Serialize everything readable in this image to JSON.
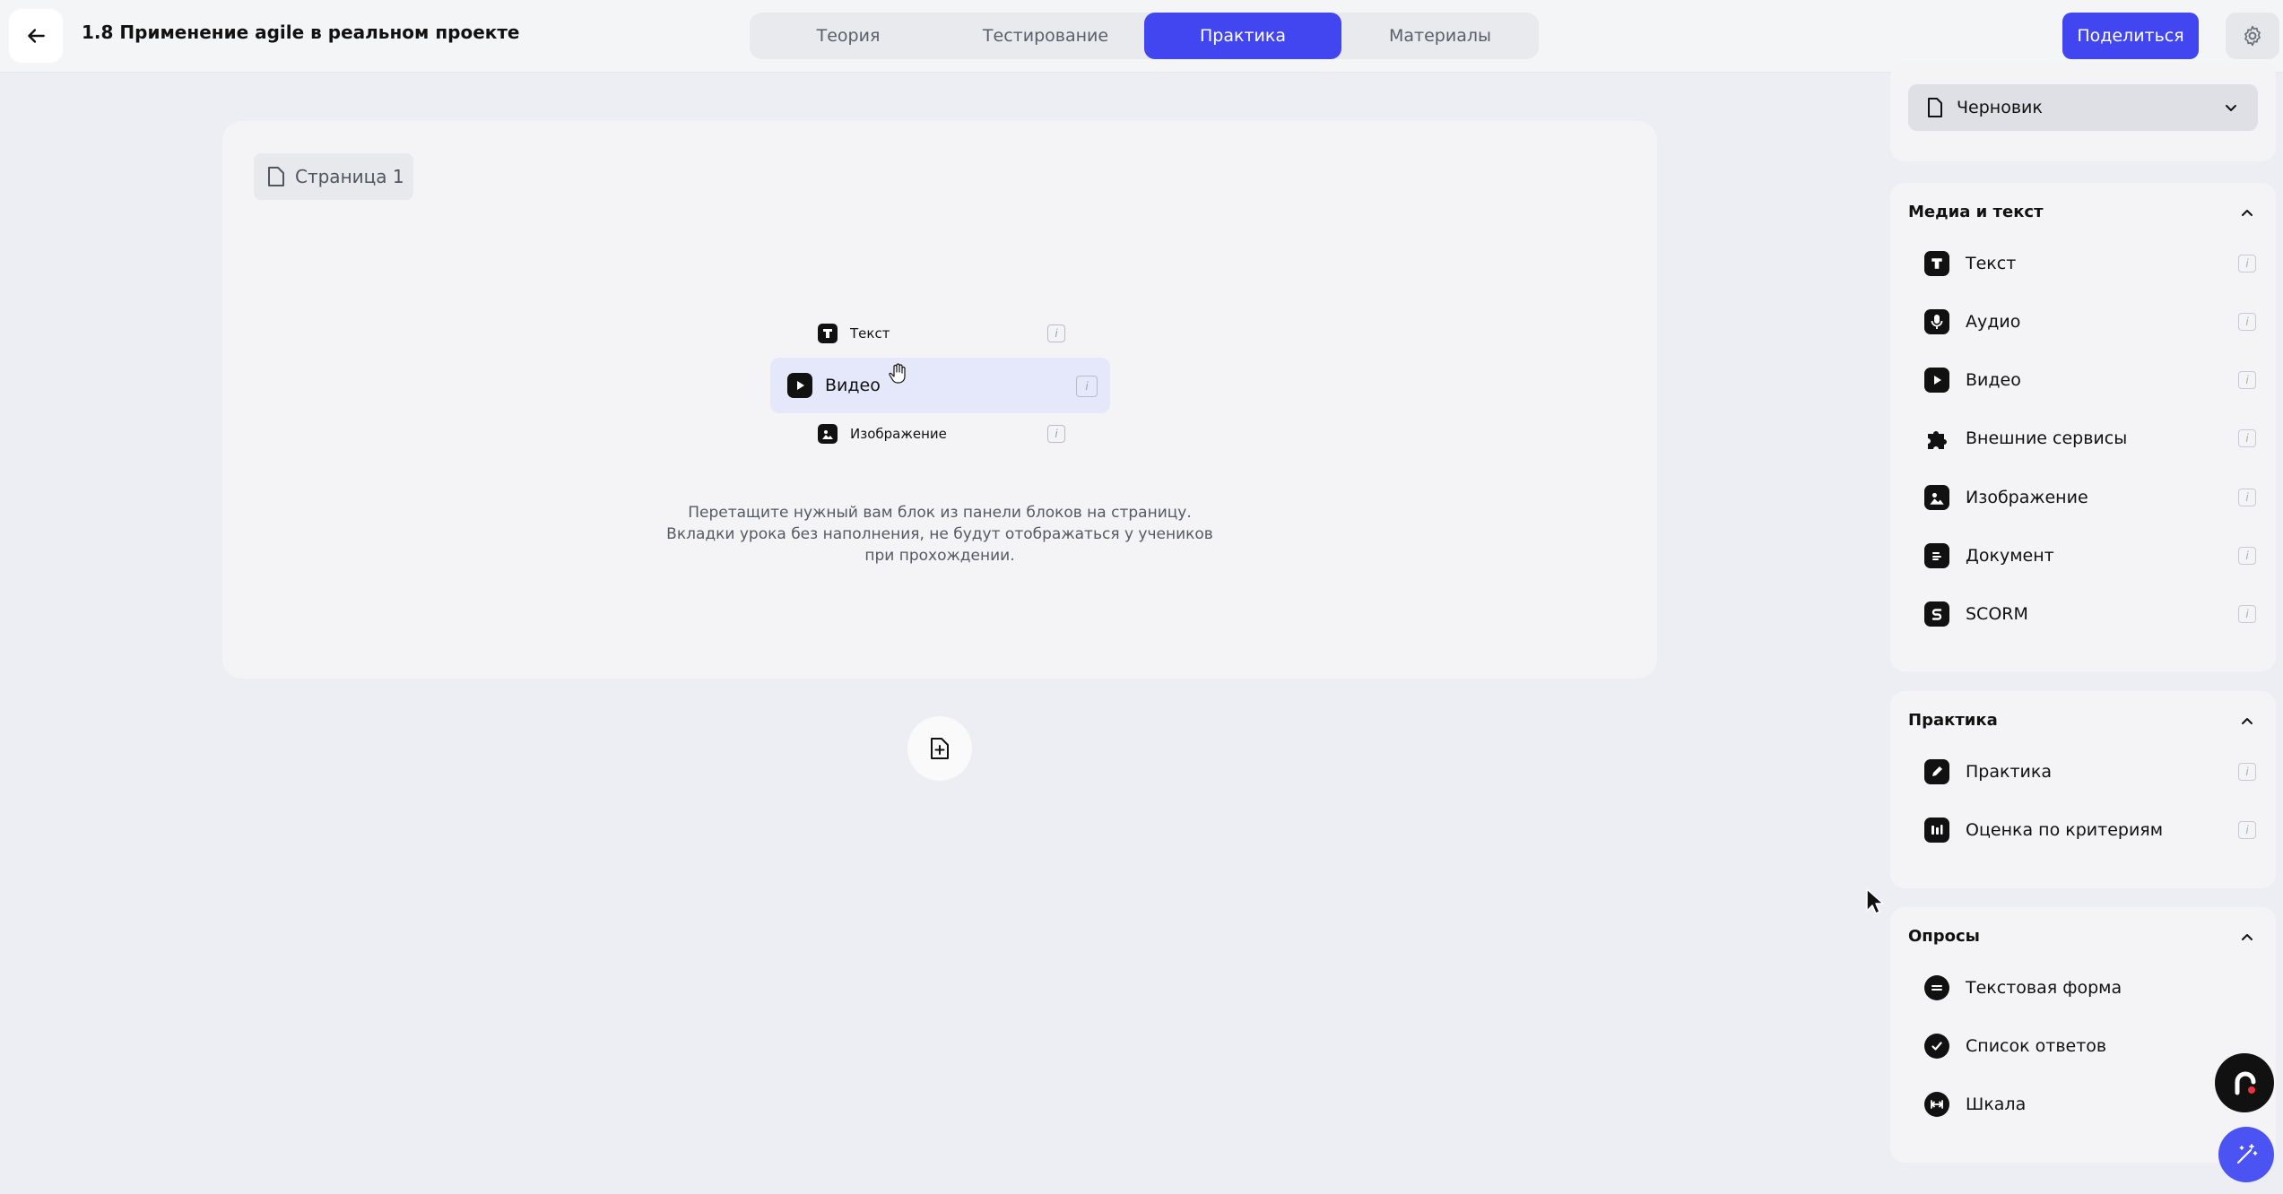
{
  "header": {
    "lesson_title": "1.8 Применение agile в реальном проекте",
    "tabs": [
      {
        "label": "Теория",
        "active": false
      },
      {
        "label": "Тестирование",
        "active": false
      },
      {
        "label": "Практика",
        "active": true
      },
      {
        "label": "Материалы",
        "active": false
      }
    ],
    "share_label": "Поделиться"
  },
  "canvas": {
    "page_label": "Страница 1",
    "drag_preview": [
      {
        "label": "Текст",
        "icon": "text-icon"
      },
      {
        "label": "Видео",
        "icon": "play-icon"
      },
      {
        "label": "Изображение",
        "icon": "image-icon"
      }
    ],
    "hint_lines": [
      "Перетащите нужный вам блок из панели блоков на страницу.",
      "Вкладки урока без наполнения, не будут отображаться у учеников",
      "при прохождении."
    ],
    "info_glyph": "i"
  },
  "panel": {
    "status_value": "Черновик",
    "sections": [
      {
        "title": "Медиа и текст",
        "items": [
          {
            "label": "Текст",
            "icon": "text-icon"
          },
          {
            "label": "Аудио",
            "icon": "microphone-icon"
          },
          {
            "label": "Видео",
            "icon": "play-icon"
          },
          {
            "label": "Внешние сервисы",
            "icon": "puzzle-icon"
          },
          {
            "label": "Изображение",
            "icon": "image-icon"
          },
          {
            "label": "Документ",
            "icon": "document-icon"
          },
          {
            "label": "SCORM",
            "icon": "scorm-icon"
          }
        ]
      },
      {
        "title": "Практика",
        "items": [
          {
            "label": "Практика",
            "icon": "pencil-icon"
          },
          {
            "label": "Оценка по критериям",
            "icon": "criteria-icon"
          }
        ]
      },
      {
        "title": "Опросы",
        "items": [
          {
            "label": "Текстовая форма",
            "icon": "text-form-icon"
          },
          {
            "label": "Список ответов",
            "icon": "checkmark-icon"
          },
          {
            "label": "Шкала",
            "icon": "scale-icon"
          }
        ]
      }
    ]
  },
  "colors": {
    "accent": "#4146f0",
    "background": "#eceef3",
    "card": "#f4f4f6"
  }
}
